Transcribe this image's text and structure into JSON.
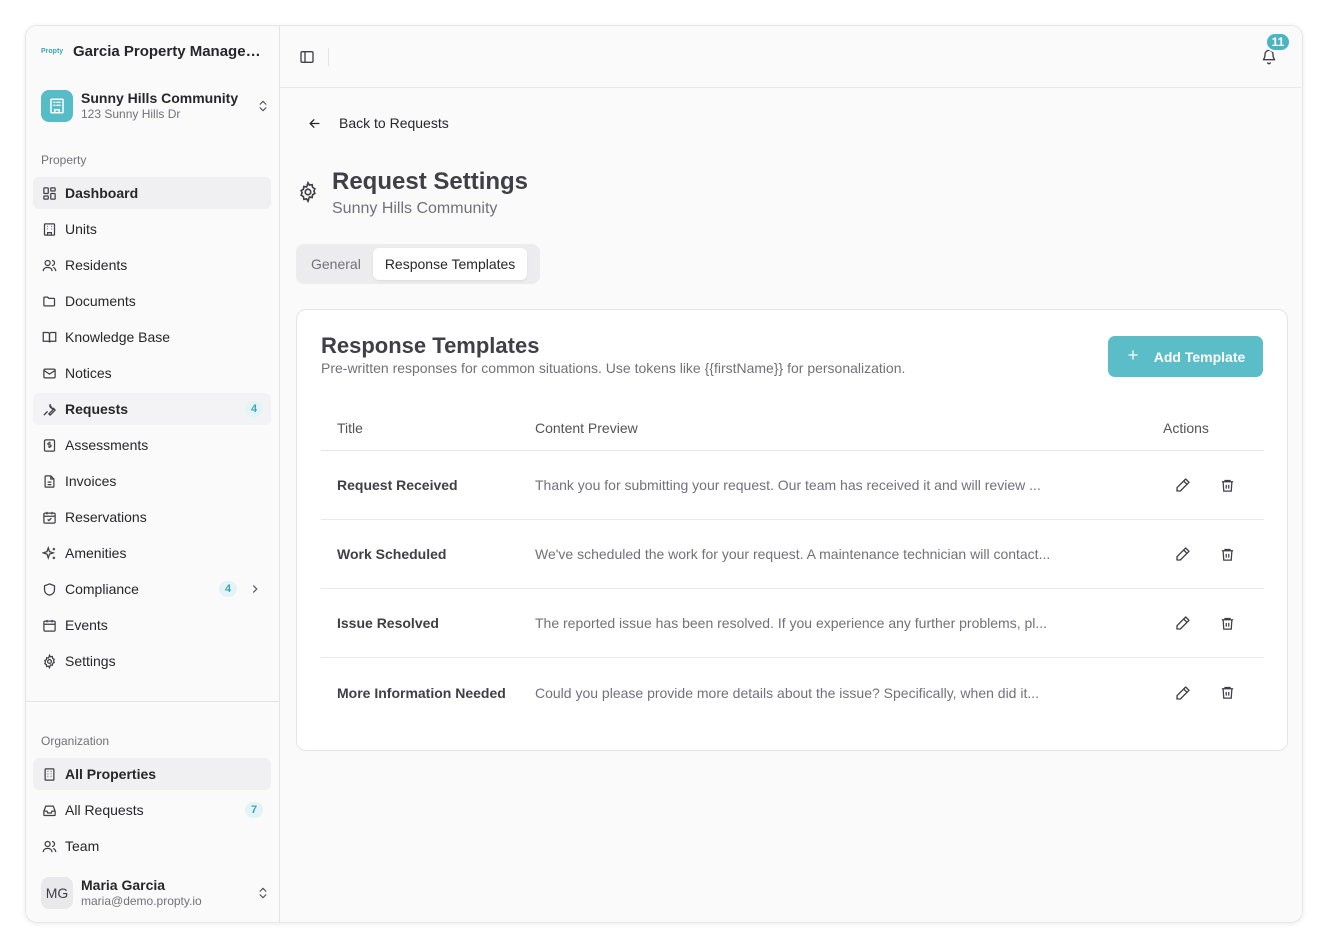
{
  "sidebar": {
    "org_logo_text": "Propty",
    "org_name": "Garcia Property Managem...",
    "property": {
      "name": "Sunny Hills Community",
      "address": "123 Sunny Hills Dr"
    },
    "property_section_label": "Property",
    "property_items": [
      {
        "label": "Dashboard",
        "icon": "dashboard-icon"
      },
      {
        "label": "Units",
        "icon": "building-icon"
      },
      {
        "label": "Residents",
        "icon": "users-icon"
      },
      {
        "label": "Documents",
        "icon": "folder-icon"
      },
      {
        "label": "Knowledge Base",
        "icon": "book-icon"
      },
      {
        "label": "Notices",
        "icon": "mail-icon"
      },
      {
        "label": "Requests",
        "icon": "wrench-icon",
        "badge": "4"
      },
      {
        "label": "Assessments",
        "icon": "dollar-icon"
      },
      {
        "label": "Invoices",
        "icon": "file-icon"
      },
      {
        "label": "Reservations",
        "icon": "calendar-check-icon"
      },
      {
        "label": "Amenities",
        "icon": "sparkles-icon"
      },
      {
        "label": "Compliance",
        "icon": "shield-icon",
        "badge": "4"
      },
      {
        "label": "Events",
        "icon": "calendar-icon"
      },
      {
        "label": "Settings",
        "icon": "gear-icon"
      }
    ],
    "organization_section_label": "Organization",
    "org_items": [
      {
        "label": "All Properties",
        "icon": "building-icon"
      },
      {
        "label": "All Requests",
        "icon": "inbox-icon",
        "badge": "7"
      },
      {
        "label": "Team",
        "icon": "users-icon"
      }
    ],
    "user": {
      "initials": "MG",
      "name": "Maria Garcia",
      "email": "maria@demo.propty.io"
    }
  },
  "topbar": {
    "notification_count": "11"
  },
  "back_label": "Back to Requests",
  "page": {
    "title": "Request Settings",
    "subtitle": "Sunny Hills Community"
  },
  "tabs": [
    {
      "label": "General"
    },
    {
      "label": "Response Templates"
    }
  ],
  "card": {
    "title": "Response Templates",
    "description": "Pre-written responses for common situations. Use tokens like {{firstName}} for personalization.",
    "add_label": "Add Template",
    "columns": {
      "title": "Title",
      "content": "Content Preview",
      "actions": "Actions"
    },
    "rows": [
      {
        "title": "Request Received",
        "content": "Thank you for submitting your request. Our team has received it and will review ..."
      },
      {
        "title": "Work Scheduled",
        "content": "We've scheduled the work for your request. A maintenance technician will contact..."
      },
      {
        "title": "Issue Resolved",
        "content": "The reported issue has been resolved. If you experience any further problems, pl..."
      },
      {
        "title": "More Information Needed",
        "content": "Could you please provide more details about the issue? Specifically, when did it..."
      }
    ]
  },
  "colors": {
    "accent": "#5bbdc8",
    "badge_bg": "#e4f3f5",
    "badge_text": "#3aa6b4"
  }
}
